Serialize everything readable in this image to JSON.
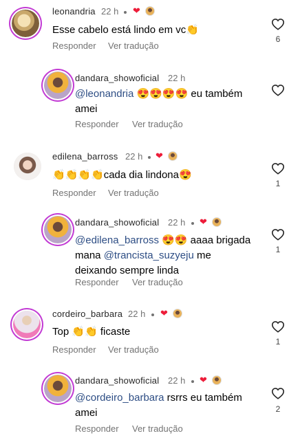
{
  "comments": [
    {
      "username": "leonandria",
      "time": "22 h",
      "text": "Esse cabelo está lindo em vc",
      "emoji": "👏",
      "reply": "Responder",
      "translate": "Ver tradução",
      "likes": "6"
    },
    {
      "username": "dandara_showoficial",
      "time": "22 h",
      "mention": "@leonandria",
      "emoji": "😍😍😍😍",
      "text": " eu também",
      "text2": "amei",
      "reply": "Responder",
      "translate": "Ver tradução"
    },
    {
      "username": "edilena_barross",
      "time": "22 h",
      "emoji": "👏👏👏👏",
      "text": "cada dia lindona",
      "emoji2": "😍",
      "reply": "Responder",
      "translate": "Ver tradução",
      "likes": "1"
    },
    {
      "username": "dandara_showoficial",
      "time": "22 h",
      "mention": "@edilena_barross",
      "emoji": "😍😍",
      "text": " aaaa brigada",
      "text2a": "mana ",
      "mention2": "@trancista_suzyeju",
      "text2b": "  me",
      "text3": "deixando sempre linda",
      "reply": "Responder",
      "translate": "Ver tradução",
      "likes": "1"
    },
    {
      "username": "cordeiro_barbara",
      "time": "22 h",
      "text": "Top ",
      "emoji": "👏👏",
      "text2": " ficaste",
      "reply": "Responder",
      "translate": "Ver tradução",
      "likes": "1"
    },
    {
      "username": "dandara_showoficial",
      "time": "22 h",
      "mention": "@cordeiro_barbara",
      "text": " rsrrs eu também",
      "text2": "amei",
      "reply": "Responder",
      "translate": "Ver tradução",
      "likes": "2"
    }
  ],
  "colors": {
    "heart_red": "#ed1d3a",
    "mention_blue": "#2d4d84",
    "muted_gray": "#737373"
  },
  "icons": {
    "like": "heart-outline-icon",
    "liked_by_author": "heart-filled-icon"
  }
}
